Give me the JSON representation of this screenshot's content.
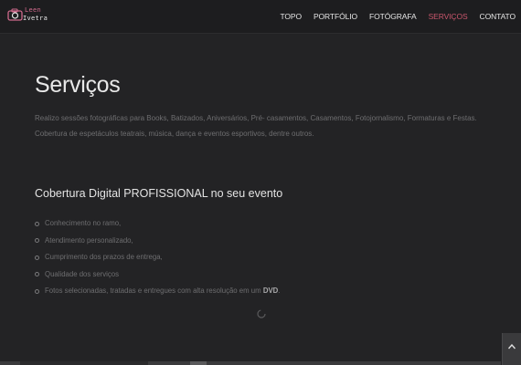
{
  "brand": {
    "line1": "Leen",
    "line2": "Ivetra",
    "accent": "#d06a8c"
  },
  "nav": {
    "items": [
      {
        "label": "TOPO"
      },
      {
        "label": "PORTFÓLIO"
      },
      {
        "label": "FOTÓGRAFA"
      },
      {
        "label": "SERVIÇOS"
      },
      {
        "label": "CONTATO"
      }
    ],
    "active_color": "#c9566c"
  },
  "section": {
    "title": "Serviços",
    "intro": "Realizo sessões fotográficas para Books, Batizados, Aniversários, Pré- casamentos, Casamentos, Fotojornalismo, Formaturas e Festas. Cobertura de espetáculos teatrais, música, dança e eventos esportivos, dentre outros.",
    "subtitle": "Cobertura Digital PROFISSIONAL no seu evento",
    "features": [
      {
        "text": "Conhecimento no ramo,"
      },
      {
        "text": "Atendimento personalizado,"
      },
      {
        "text": "Cumprimento dos prazos de entrega,"
      },
      {
        "text": "Qualidade dos serviços"
      },
      {
        "text": "Fotos selecionadas, tratadas e entregues com alta resolução em um ",
        "bold": "DVD",
        "end": "."
      }
    ]
  },
  "icons": {
    "logo": "camera-icon",
    "loader": "loading-spinner-icon",
    "back_to_top": "chevron-up-icon"
  },
  "colors": {
    "background": "#232325",
    "navbar": "#1d1d1f",
    "text_muted": "#6e6e70"
  }
}
